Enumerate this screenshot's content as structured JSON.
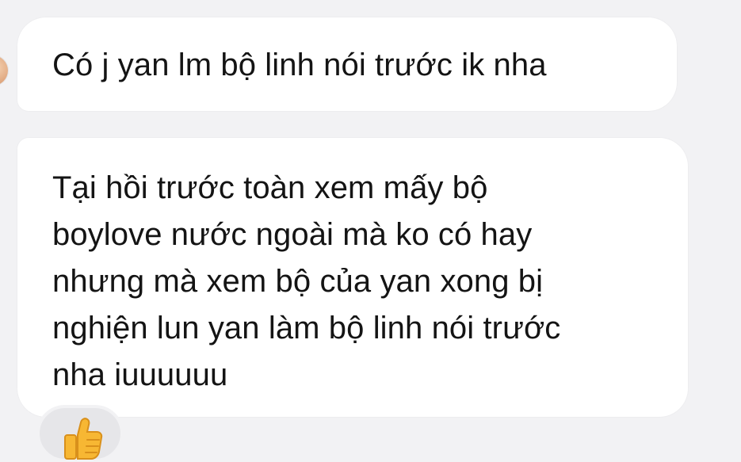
{
  "messages": [
    {
      "text": "Có j yan lm bộ linh nói trước ik nha"
    },
    {
      "text": "Tại hồi trước toàn xem mấy bộ\nboylove nước ngoài mà ko có hay\nnhưng mà xem bộ của yan xong bị\nnghiện lun yan làm bộ linh nói trước\nnha iuuuuuu"
    }
  ],
  "reaction": {
    "icon": "thumbs-up-icon",
    "color": "#f7b733"
  },
  "colors": {
    "background": "#f2f2f4",
    "bubble": "#ffffff",
    "text": "#141414",
    "reaction_chip": "#e6e6e9"
  }
}
